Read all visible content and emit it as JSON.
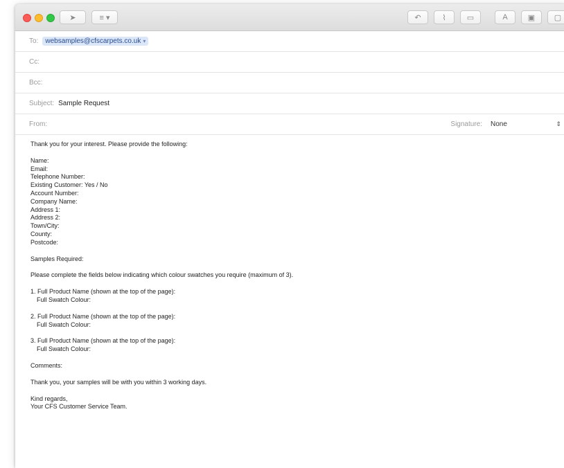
{
  "toolbar": {
    "send_icon": "paper-plane-icon",
    "header_fields_icon": "list-menu-icon",
    "buttons": [
      {
        "name": "reply-arrow-icon",
        "glyph": "↶"
      },
      {
        "name": "attach-icon",
        "glyph": "⌇"
      },
      {
        "name": "markup-icon",
        "glyph": "▭"
      },
      {
        "name": "format-font-icon",
        "glyph": "A"
      },
      {
        "name": "photo-browser-icon",
        "glyph": "▣"
      }
    ]
  },
  "header": {
    "to_label": "To:",
    "to_value": "websamples@cfscarpets.co.uk",
    "cc_label": "Cc:",
    "bcc_label": "Bcc:",
    "subject_label": "Subject:",
    "subject_value": "Sample Request",
    "from_label": "From:",
    "signature_label": "Signature:",
    "signature_value": "None"
  },
  "body": {
    "intro": "Thank you for your interest. Please provide the following:",
    "fields": [
      "Name:",
      "Email:",
      "Telephone Number:",
      "Existing Customer: Yes / No",
      "Account Number:",
      "Company Name:",
      "Address 1:",
      "Address 2:",
      "Town/City:",
      "County:",
      "Postcode:"
    ],
    "samples_heading": "Samples Required:",
    "samples_instruction": "Please complete the fields below indicating which colour swatches you require (maximum of 3).",
    "samples": [
      {
        "product": "1. Full Product Name (shown at the top of the page):",
        "colour": "Full Swatch Colour:"
      },
      {
        "product": "2. Full Product Name (shown at the top of the page):",
        "colour": "Full Swatch Colour:"
      },
      {
        "product": "3. Full Product Name (shown at the top of the page):",
        "colour": "Full Swatch Colour:"
      }
    ],
    "comments": "Comments:",
    "thanks": "Thank you, your samples will be with you within 3 working days.",
    "signoff_1": "Kind regards,",
    "signoff_2": "Your CFS Customer Service Team."
  }
}
